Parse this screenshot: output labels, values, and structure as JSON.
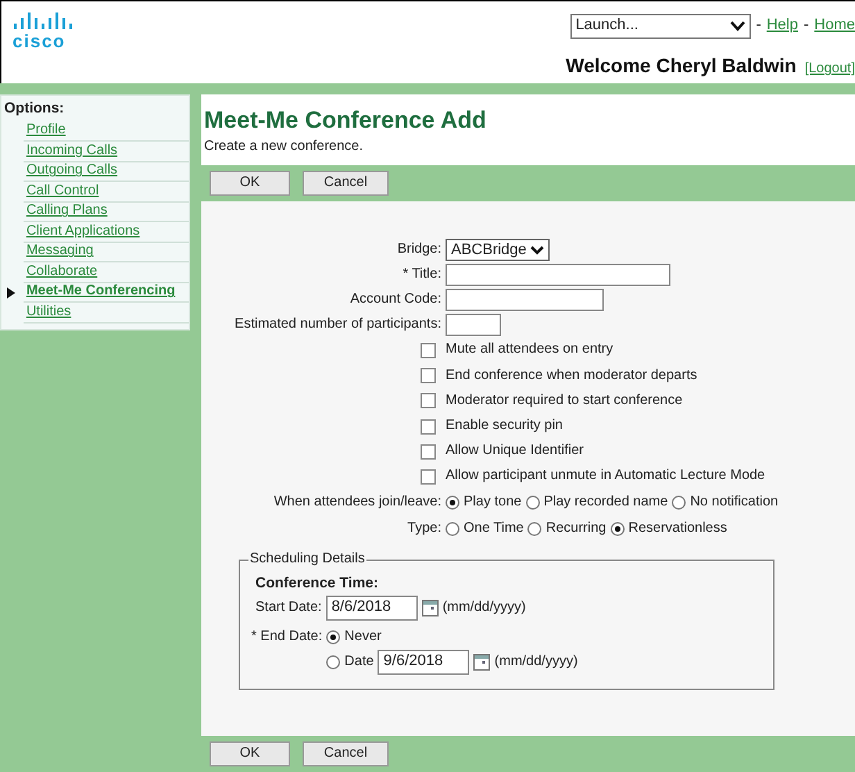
{
  "header": {
    "logo_text": "cisco",
    "launch": {
      "value": "Launch..."
    },
    "links": [
      {
        "separator": "-",
        "label": "Help"
      },
      {
        "separator": "-",
        "label": "Home"
      }
    ],
    "welcome": "Welcome Cheryl Baldwin",
    "logout": "[Logout]"
  },
  "sidebar": {
    "title": "Options:",
    "items": [
      {
        "label": "Profile",
        "selected": false
      },
      {
        "label": "Incoming Calls",
        "selected": false
      },
      {
        "label": "Outgoing Calls",
        "selected": false
      },
      {
        "label": "Call Control",
        "selected": false
      },
      {
        "label": "Calling Plans",
        "selected": false
      },
      {
        "label": "Client Applications",
        "selected": false
      },
      {
        "label": "Messaging",
        "selected": false
      },
      {
        "label": "Collaborate",
        "selected": false
      },
      {
        "label": "Meet-Me Conferencing",
        "selected": true
      },
      {
        "label": "Utilities",
        "selected": false
      }
    ]
  },
  "page": {
    "title": "Meet-Me Conference Add",
    "subtitle": "Create a new conference.",
    "top_buttons": [
      "OK",
      "Cancel"
    ],
    "bottom_buttons": [
      "OK",
      "Cancel"
    ]
  },
  "form": [
    {
      "kind": "select",
      "label": "Bridge:",
      "value": "ABCBridge"
    },
    {
      "kind": "text",
      "label": "* Title:"
    },
    {
      "kind": "text",
      "label": "Account Code:"
    },
    {
      "kind": "text",
      "label": "Estimated number of participants:"
    },
    {
      "kind": "checkbox",
      "label": "Mute all attendees on entry",
      "checked": false
    },
    {
      "kind": "checkbox",
      "label": "End conference when moderator departs",
      "checked": false
    },
    {
      "kind": "checkbox",
      "label": "Moderator required to start conference",
      "checked": false
    },
    {
      "kind": "checkbox",
      "label": "Enable security pin",
      "checked": false
    },
    {
      "kind": "checkbox",
      "label": "Allow Unique Identifier",
      "checked": false
    },
    {
      "kind": "checkbox",
      "label": "Allow participant unmute in Automatic Lecture Mode",
      "checked": false
    },
    {
      "kind": "radio",
      "label": "When attendees join/leave:",
      "options": [
        {
          "label": "Play tone",
          "selected": true
        },
        {
          "label": "Play recorded name",
          "selected": false
        },
        {
          "label": "No notification",
          "selected": false
        }
      ]
    },
    {
      "kind": "radio",
      "label": "Type:",
      "options": [
        {
          "label": "One Time",
          "selected": false
        },
        {
          "label": "Recurring",
          "selected": false
        },
        {
          "label": "Reservationless",
          "selected": true
        }
      ]
    }
  ],
  "scheduling": {
    "legend": "Scheduling Details",
    "heading": "Conference Time:",
    "start_label": "Start Date:",
    "start_value": "8/6/2018",
    "start_hint": "(mm/dd/yyyy)",
    "end_label": "* End Date:",
    "end_options": [
      {
        "label": "Never",
        "selected": true
      },
      {
        "label": "Date",
        "selected": false,
        "value": "9/6/2018",
        "hint": "(mm/dd/yyyy)"
      }
    ]
  }
}
